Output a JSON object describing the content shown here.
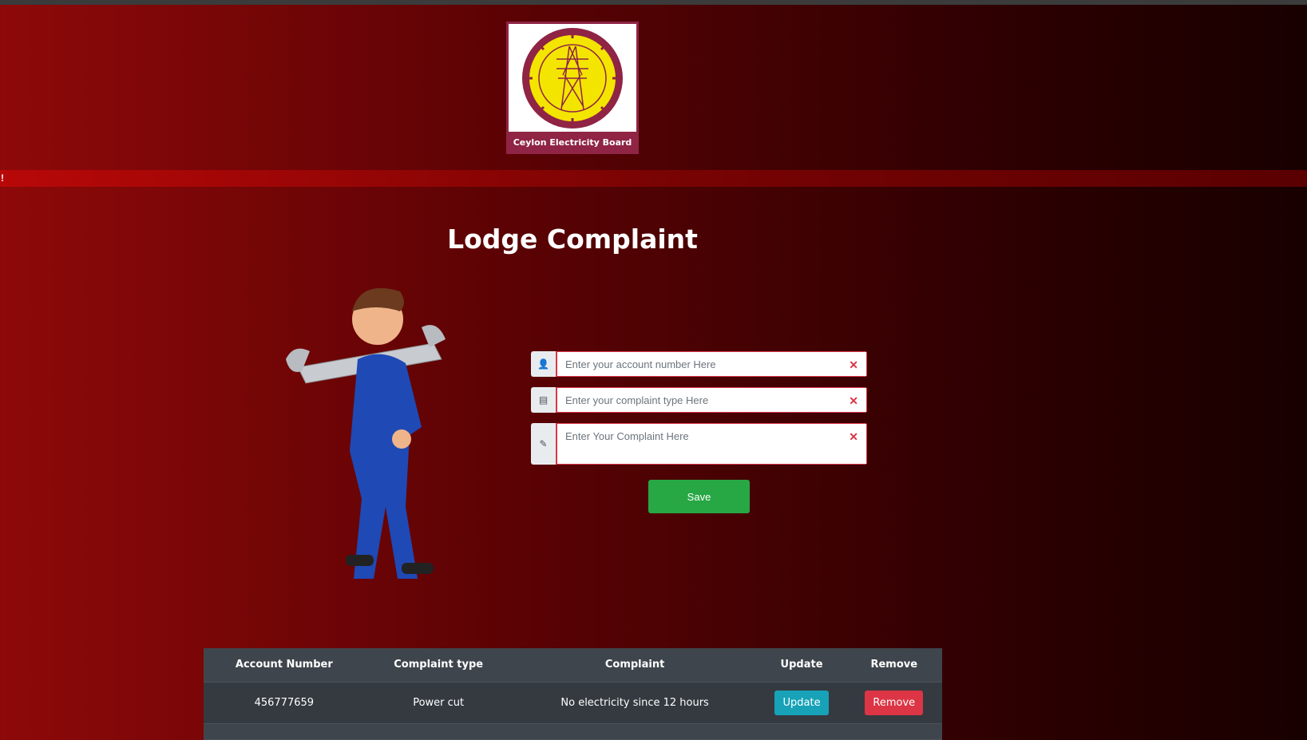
{
  "header": {
    "logo_text": "Ceylon Electricity Board",
    "band_text": "!"
  },
  "page": {
    "title": "Lodge Complaint"
  },
  "form": {
    "account_placeholder": "Enter your account number Here",
    "type_placeholder": "Enter your complaint type Here",
    "complaint_placeholder": "Enter Your Complaint Here",
    "clear_glyph": "✕",
    "save_label": "Save"
  },
  "table": {
    "headers": [
      "Account Number",
      "Complaint type",
      "Complaint",
      "Update",
      "Remove"
    ],
    "rows": [
      {
        "account": "456777659",
        "type": "Power cut",
        "complaint": "No electricity since 12 hours",
        "update": "Update",
        "remove": "Remove"
      }
    ]
  },
  "colors": {
    "accent": "#dc3545",
    "save": "#28a745",
    "update": "#17a2b8"
  }
}
